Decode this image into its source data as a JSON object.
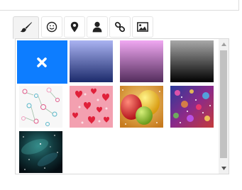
{
  "toolbar": {
    "tools": [
      {
        "name": "brush",
        "icon": "paintbrush-icon",
        "active": true
      },
      {
        "name": "emoji",
        "icon": "smiley-icon",
        "active": false
      },
      {
        "name": "location",
        "icon": "map-marker-icon",
        "active": false
      },
      {
        "name": "person",
        "icon": "user-icon",
        "active": false
      },
      {
        "name": "link",
        "icon": "link-icon",
        "active": false
      },
      {
        "name": "image",
        "icon": "image-icon",
        "active": false
      }
    ]
  },
  "background_picker": {
    "swatches": [
      {
        "name": "no-background",
        "type": "clear",
        "color": "#0d7dff",
        "icon": "close-icon"
      },
      {
        "name": "blue-gradient",
        "type": "gradient",
        "from": "#aab3f2",
        "to": "#1b2a6b"
      },
      {
        "name": "purple-gradient",
        "type": "gradient",
        "from": "#f0a8f2",
        "to": "#532c5c"
      },
      {
        "name": "gray-gradient",
        "type": "gradient",
        "from": "#a8a8a8",
        "to": "#000000"
      },
      {
        "name": "floral-pattern",
        "type": "pattern",
        "background": "#f7f7f7"
      },
      {
        "name": "hearts-pattern",
        "type": "pattern",
        "background": "#f3a0b0"
      },
      {
        "name": "balloons-image",
        "type": "image",
        "background": "#e5a93a"
      },
      {
        "name": "glitter-image",
        "type": "image",
        "background": "#6a2a86"
      },
      {
        "name": "galaxy-image",
        "type": "image",
        "background": "#0b1c1c"
      }
    ],
    "scrollbar": {
      "position": 0.0
    }
  }
}
